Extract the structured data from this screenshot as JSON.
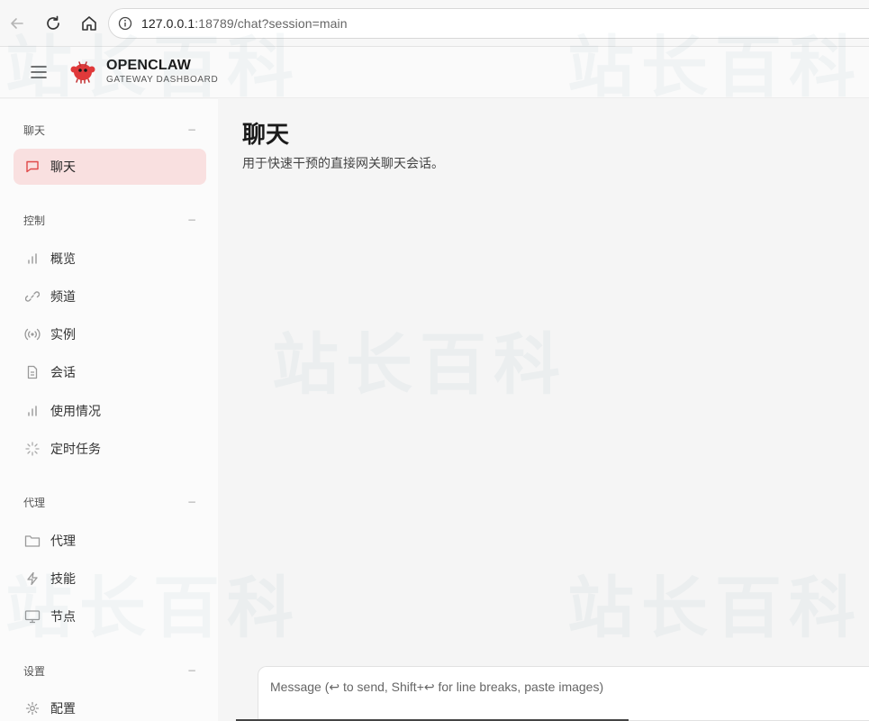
{
  "browser": {
    "url_host": "127.0.0.1",
    "url_rest": ":18789/chat?session=main"
  },
  "header": {
    "title": "OPENCLAW",
    "subtitle": "GATEWAY DASHBOARD"
  },
  "sidebar": {
    "sections": [
      {
        "title": "聊天",
        "items": [
          {
            "label": "聊天",
            "icon": "chat-bubble-icon",
            "active": true
          }
        ]
      },
      {
        "title": "控制",
        "items": [
          {
            "label": "概览",
            "icon": "bar-chart-icon"
          },
          {
            "label": "频道",
            "icon": "link-icon"
          },
          {
            "label": "实例",
            "icon": "broadcast-icon"
          },
          {
            "label": "会话",
            "icon": "document-icon"
          },
          {
            "label": "使用情况",
            "icon": "bar-chart-icon"
          },
          {
            "label": "定时任务",
            "icon": "loader-icon"
          }
        ]
      },
      {
        "title": "代理",
        "items": [
          {
            "label": "代理",
            "icon": "folder-icon"
          },
          {
            "label": "技能",
            "icon": "lightning-icon"
          },
          {
            "label": "节点",
            "icon": "monitor-icon"
          }
        ]
      },
      {
        "title": "设置",
        "items": [
          {
            "label": "配置",
            "icon": "gear-icon"
          }
        ]
      }
    ],
    "collapse_symbol": "−"
  },
  "main": {
    "title": "聊天",
    "subtitle": "用于快速干预的直接网关聊天会话。",
    "composer_placeholder": "Message (↩ to send, Shift+↩ for line breaks, paste images)"
  },
  "watermark": "站长百科",
  "colors": {
    "accent": "#e04848",
    "active_bg": "#f9e0e0"
  }
}
